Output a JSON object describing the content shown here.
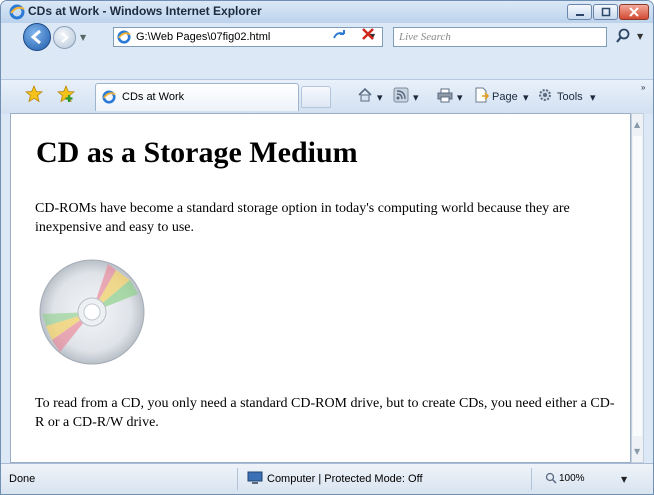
{
  "window": {
    "title": "CDs at Work - Windows Internet Explorer"
  },
  "toolbar": {
    "address": "G:\\Web Pages\\07fig02.html",
    "search_placeholder": "Live Search"
  },
  "tabs": [
    {
      "label": "CDs at Work"
    }
  ],
  "commandbar": {
    "page_label": "Page",
    "tools_label": "Tools"
  },
  "page": {
    "heading": "CD as a Storage Medium",
    "paragraph1": "CD-ROMs have become a standard storage option in today's computing world because they are inexpensive and easy to use.",
    "paragraph2": "To read from a CD, you only need a standard CD-ROM drive, but to create CDs, you need either a CD-R or a CD-R/W drive."
  },
  "statusbar": {
    "status": "Done",
    "zone": "Computer | Protected Mode: Off",
    "zoom": "100%"
  },
  "icons": {
    "browser": "ie-icon",
    "back": "back-arrow-icon",
    "forward": "forward-arrow-icon",
    "refresh": "refresh-icon",
    "stop": "stop-icon",
    "search": "search-icon",
    "favorites": "favorites-star-icon",
    "add_favorite": "add-favorites-icon",
    "home": "home-icon",
    "feeds": "feeds-icon",
    "print": "print-icon",
    "page": "page-icon",
    "tools": "tools-gear-icon",
    "zone": "computer-zone-icon",
    "zoom": "zoom-icon",
    "cd": "cd-disc-image"
  },
  "colors": {
    "chrome": "#dce8f5",
    "close_button": "#d24a32",
    "content_bg": "#ffffff"
  }
}
